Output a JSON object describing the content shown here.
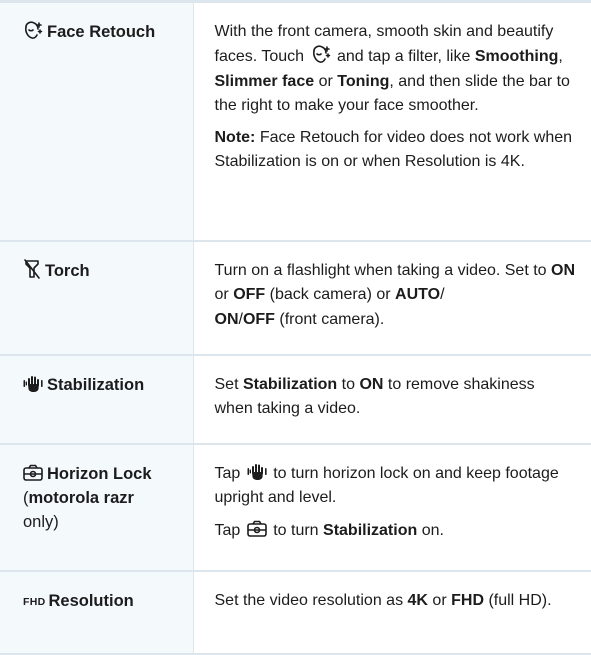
{
  "rows": [
    {
      "icon": "face-retouch-icon",
      "feature": "Face Retouch",
      "desc": {
        "p1_a": "With the front camera, smooth skin and beautify faces. Touch",
        "p1_b": "and tap a filter, like",
        "p1_b1": "Smoothing",
        "p1_c": ",",
        "p1_b2": "Slimmer face",
        "p1_d": "or",
        "p1_b3": "Toning",
        "p1_e": ", and then slide the bar to the right to make your face smoother.",
        "note_label": "Note:",
        "note_text": "Face Retouch for video does not work when Stabilization is on or when Resolution is 4K."
      }
    },
    {
      "icon": "torch-icon",
      "feature": "Torch",
      "desc": {
        "a": "Turn on a flashlight when taking a video. Set to",
        "b1": "ON",
        "c": "or",
        "b2": "OFF",
        "d": "(back camera) or",
        "b3": "AUTO",
        "e": "/",
        "b4": "ON",
        "f": "/",
        "b5": "OFF",
        "g": "(front camera)."
      }
    },
    {
      "icon": "stabilization-icon",
      "feature": "Stabilization",
      "desc": {
        "a": "Set",
        "b1": "Stabilization",
        "c": "to",
        "b2": "ON",
        "d": "to remove shakiness when taking a video."
      }
    },
    {
      "icon": "horizon-lock-icon",
      "feature": "Horizon Lock",
      "feature_note_open": "(",
      "feature_note_bold": "motorola razr",
      "feature_note_close": " only)",
      "desc": {
        "p1_a": "Tap",
        "p1_b": "to turn horizon lock on and keep footage upright and level.",
        "p2_a": "Tap",
        "p2_b": "to turn",
        "p2_bold": "Stabilization",
        "p2_c": "on."
      }
    },
    {
      "icon": "resolution-icon",
      "icon_text": "FHD",
      "feature": "Resolution",
      "desc": {
        "a": "Set the video resolution as",
        "b1": "4K",
        "c": "or",
        "b2": "FHD",
        "d": "(full HD)."
      }
    }
  ]
}
